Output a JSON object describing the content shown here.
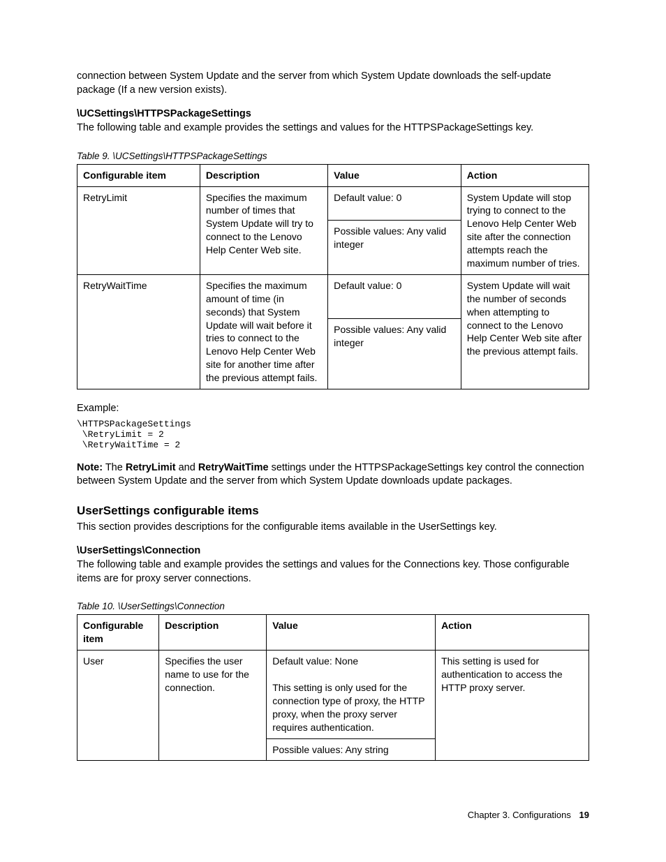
{
  "intro": "connection between System Update and the server from which System Update downloads the self-update package (If a new version exists).",
  "uc": {
    "heading": "\\UCSettings\\HTTPSPackageSettings",
    "desc": "The following table and example provides the settings and values for the HTTPSPackageSettings key.",
    "caption": "Table 9.  \\UCSettings\\HTTPSPackageSettings",
    "headers": {
      "c1": "Configurable item",
      "c2": "Description",
      "c3": "Value",
      "c4": "Action"
    },
    "rows": [
      {
        "item": "RetryLimit",
        "desc": "Specifies the maximum number of times that System Update will try to connect to the Lenovo Help Center Web site.",
        "val1": "Default value: 0",
        "val2": "Possible values: Any valid integer",
        "action": "System Update will stop trying to connect to the Lenovo Help Center Web site after the connection attempts reach the maximum number of tries."
      },
      {
        "item": "RetryWaitTime",
        "desc": "Specifies the maximum amount of time (in seconds) that System Update will wait before it tries to connect to the Lenovo Help Center Web site for another time after the previous attempt fails.",
        "val1": "Default value: 0",
        "val2": "Possible values: Any valid integer",
        "action": "System Update will wait the number of seconds when attempting to connect to the Lenovo Help Center Web site after the previous attempt fails."
      }
    ]
  },
  "example_label": "Example:",
  "code": "\\HTTPSPackageSettings\n \\RetryLimit = 2\n \\RetryWaitTime = 2",
  "note": {
    "prefix": "Note:",
    "mid1": " The ",
    "b1": "RetryLimit",
    "mid2": " and ",
    "b2": "RetryWaitTime",
    "rest": " settings under the HTTPSPackageSettings key control the connection between System Update and the server from which System Update downloads update packages."
  },
  "us": {
    "heading": "UserSettings configurable items",
    "desc": "This section provides descriptions for the configurable items available in the UserSettings key.",
    "sub": "\\UserSettings\\Connection",
    "subdesc": "The following table and example provides the settings and values for the Connections key. Those configurable items are for proxy server connections.",
    "caption": "Table 10.  \\UserSettings\\Connection",
    "headers": {
      "c1": "Configurable item",
      "c2": "Description",
      "c3": "Value",
      "c4": "Action"
    },
    "row": {
      "item": "User",
      "desc": "Specifies the user name to use for the connection.",
      "val1": "Default value: None\n\nThis setting is only used for the connection type of proxy, the HTTP proxy, when the proxy server requires authentication.",
      "val2": "Possible values: Any string",
      "action": "This setting is used for authentication to access the HTTP proxy server."
    }
  },
  "footer": {
    "chapter": "Chapter 3. Configurations",
    "page": "19"
  }
}
